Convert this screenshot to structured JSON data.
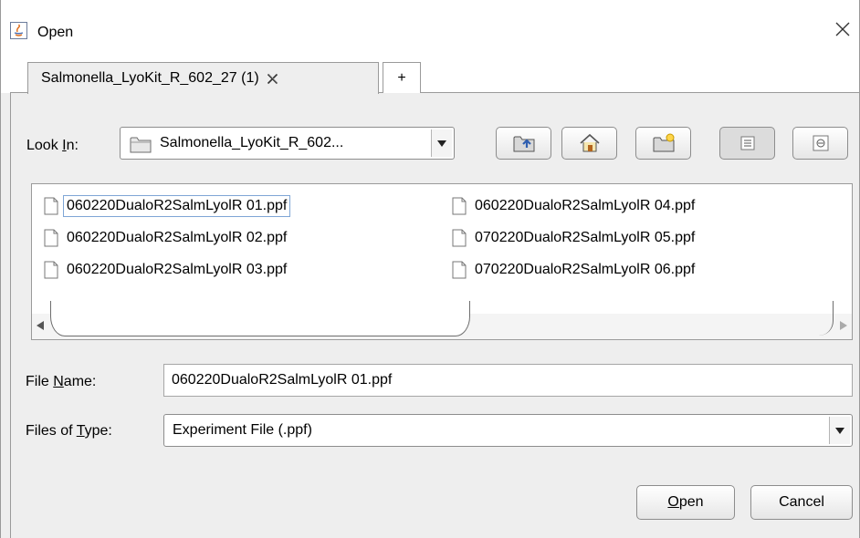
{
  "window": {
    "title": "Open"
  },
  "tabs": [
    {
      "label": "Salmonella_LyoKit_R_602_27 (1)",
      "active": true
    },
    {
      "label": "+"
    }
  ],
  "look_in": {
    "label_pre": "Look ",
    "label_mnemonic": "I",
    "label_post": "n:",
    "value": "Salmonella_LyoKit_R_602..."
  },
  "toolbar": {
    "buttons": [
      "up-one-level-icon",
      "home-icon",
      "new-folder-icon",
      "list-view-icon",
      "details-view-icon"
    ]
  },
  "files": [
    "060220DualoR2SalmLyolR 01.ppf",
    "060220DualoR2SalmLyolR 02.ppf",
    "060220DualoR2SalmLyolR 03.ppf",
    "060220DualoR2SalmLyolR 04.ppf",
    "070220DualoR2SalmLyolR 05.ppf",
    "070220DualoR2SalmLyolR 06.ppf"
  ],
  "file_name": {
    "label_pre": "File ",
    "label_mnemonic": "N",
    "label_post": "ame:",
    "value": "060220DualoR2SalmLyolR 01.ppf"
  },
  "file_type": {
    "label_pre": "Files of ",
    "label_mnemonic": "T",
    "label_post": "ype:",
    "value": "Experiment File (.ppf)"
  },
  "buttons": {
    "open_mnemonic": "O",
    "open_rest": "pen",
    "cancel": "Cancel"
  }
}
